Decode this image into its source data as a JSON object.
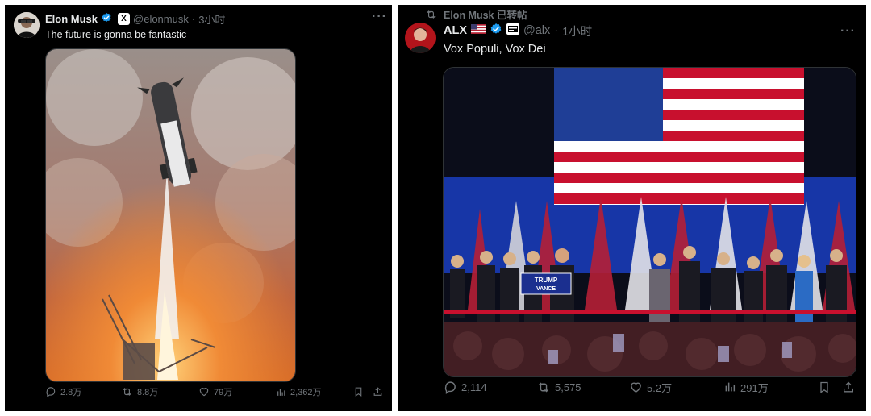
{
  "left_tweet": {
    "author_name": "Elon Musk",
    "affiliate_badge": "X",
    "handle": "@elonmusk",
    "separator": "·",
    "time": "3小时",
    "more_label": "···",
    "text": "The future is gonna be fantastic",
    "media_description_icon": "rocket-launch-photo",
    "stats": {
      "replies": "2.8万",
      "reposts": "8.8万",
      "likes": "79万",
      "views": "2,362万"
    }
  },
  "right_tweet": {
    "repost_context": "Elon Musk 已转帖",
    "author_name": "ALX",
    "flag": "🇺🇸",
    "handle": "@alx",
    "separator": "·",
    "time": "1小时",
    "more_label": "···",
    "text": "Vox Populi, Vox Dei",
    "media_description_icon": "victory-stage-photo",
    "podium_sign_line1": "TRUMP",
    "podium_sign_line2": "VANCE",
    "stats": {
      "replies": "2,114",
      "reposts": "5,575",
      "likes": "5.2万",
      "views": "291万"
    }
  },
  "colors": {
    "background": "#000000",
    "text": "#e7e9ea",
    "muted": "#71767b",
    "verified_blue": "#1d9bf0",
    "border": "#2f3336"
  }
}
